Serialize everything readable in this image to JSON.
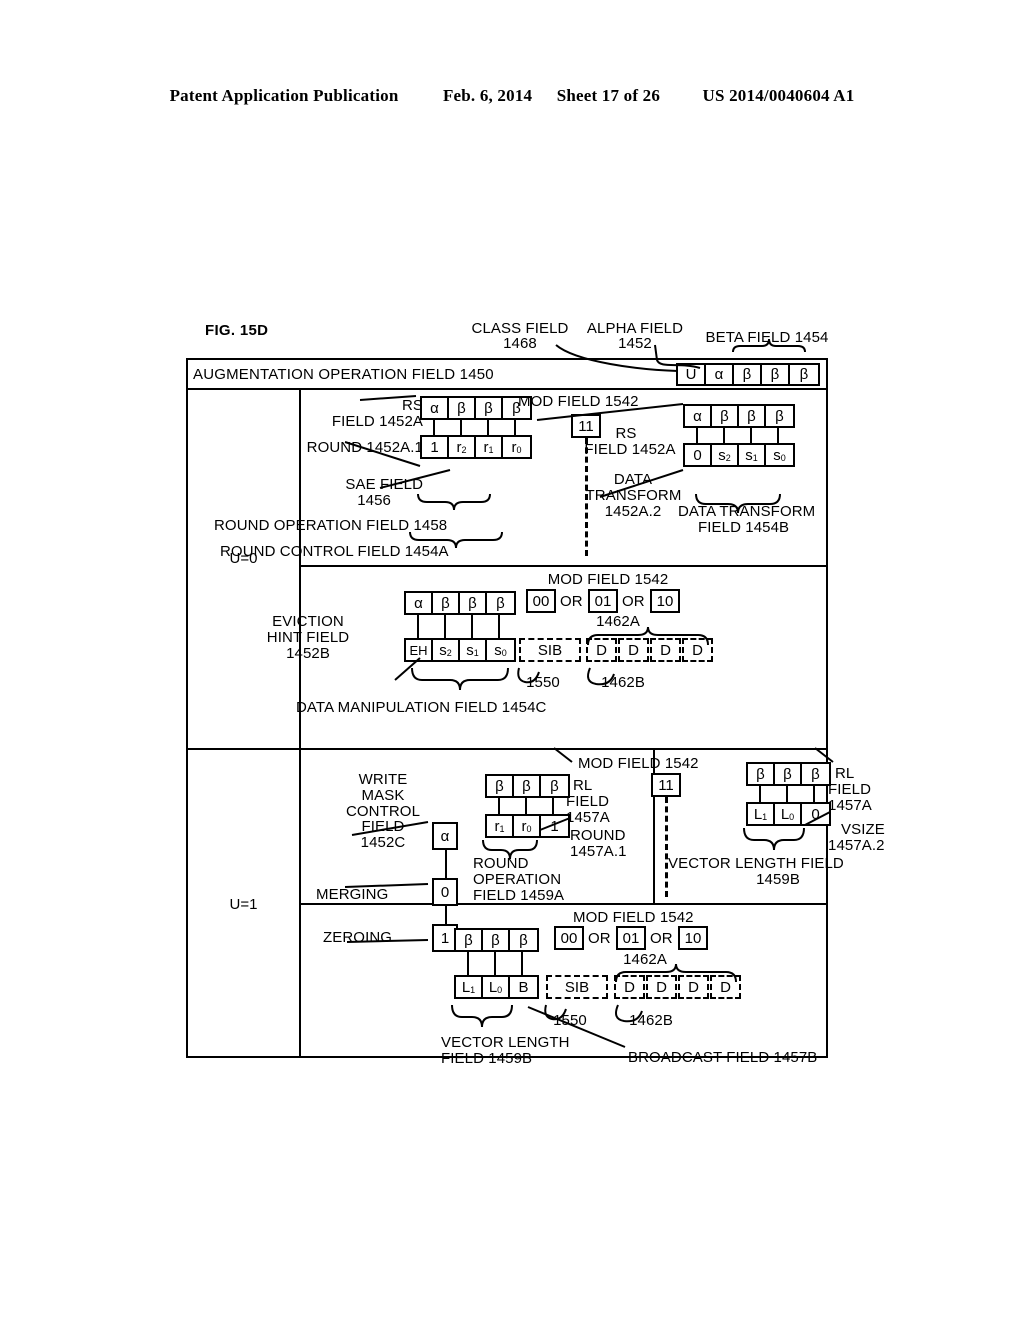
{
  "page_header": {
    "publication": "Patent Application Publication",
    "date": "Feb. 6, 2014",
    "sheet": "Sheet 17 of 26",
    "patent_number": "US 2014/0040604 A1"
  },
  "figure": {
    "label": "FIG. 15D",
    "header_row": {
      "title": "AUGMENTATION OPERATION FIELD 1450",
      "cells": [
        "U",
        "α",
        "β",
        "β",
        "β"
      ],
      "callouts": {
        "class_field": "CLASS FIELD\n1468",
        "alpha_field": "ALPHA FIELD\n1452",
        "beta_field": "BETA FIELD 1454"
      }
    },
    "rows": [
      {
        "u_label": "U=0",
        "sections": [
          {
            "name": "round-control",
            "labels": {
              "rs_field": "RS",
              "rs_field_num": "FIELD 1452A",
              "round": "ROUND 1452A.1",
              "sae_field": "SAE FIELD",
              "sae_num": "1456",
              "round_operation": "ROUND OPERATION FIELD 1458",
              "round_control": "ROUND CONTROL FIELD 1454A",
              "mod_field": "MOD FIELD 1542",
              "rs_field_r": "RS",
              "rs_field_r_num": "FIELD 1452A",
              "data_transform": "DATA",
              "data_transform2": "TRANSFORM",
              "data_transform_num": "1452A.2",
              "data_transform_field": "DATA TRANSFORM",
              "data_transform_field_num": "FIELD 1454B"
            },
            "top_cells": [
              "α",
              "β",
              "β",
              "β"
            ],
            "bottom_cells": [
              "1",
              "r2",
              "r1",
              "r0"
            ],
            "mod_value": "11",
            "top_cells_r": [
              "α",
              "β",
              "β",
              "β"
            ],
            "bottom_cells_r": [
              "0",
              "s2",
              "s1",
              "s0"
            ]
          },
          {
            "name": "data-manipulation",
            "labels": {
              "eviction_hint": "EVICTION",
              "eviction_hint2": "HINT FIELD",
              "eviction_hint_num": "1452B",
              "data_manipulation": "DATA MANIPULATION FIELD 1454C",
              "mod_field": "MOD FIELD 1542",
              "ref_1462a": "1462A",
              "ref_1550": "1550",
              "ref_1462b": "1462B"
            },
            "top_cells": [
              "α",
              "β",
              "β",
              "β"
            ],
            "bottom_cells": [
              "EH",
              "s2",
              "s1",
              "s0"
            ],
            "mod_values": [
              "00",
              "01",
              "10"
            ],
            "mod_or": "OR",
            "sib": "SIB",
            "disp_cells": [
              "D",
              "D",
              "D",
              "D"
            ]
          }
        ]
      },
      {
        "u_label": "U=1",
        "left_labels": {
          "write_mask": "WRITE\nMASK\nCONTROL\nFIELD\n1452C",
          "merging": "MERGING",
          "zeroing": "ZEROING",
          "alpha_cell": "α",
          "merging_cell": "0",
          "zeroing_cell": "1"
        },
        "sections": [
          {
            "name": "round-vsize",
            "labels": {
              "mod_field": "MOD FIELD 1542",
              "rl_field": "RL",
              "rl_field2": "FIELD",
              "rl_field_num": "1457A",
              "round": "ROUND",
              "round_num": "1457A.1",
              "round_operation": "ROUND\nOPERATION\nFIELD 1459A",
              "rl_field_r": "RL",
              "rl_field_r2": "FIELD",
              "rl_field_r_num": "1457A",
              "vsize": "VSIZE",
              "vsize_num": "1457A.2",
              "vector_length": "VECTOR LENGTH FIELD",
              "vector_length_num": "1459B"
            },
            "top_cells": [
              "β",
              "β",
              "β"
            ],
            "bottom_cells": [
              "r1",
              "r0",
              "1"
            ],
            "mod_value": "11",
            "top_cells_r": [
              "β",
              "β",
              "β"
            ],
            "bottom_cells_r": [
              "L1",
              "L0",
              "0"
            ]
          },
          {
            "name": "vector-length-broadcast",
            "labels": {
              "mod_field": "MOD FIELD 1542",
              "ref_1462a": "1462A",
              "ref_1550": "1550",
              "ref_1462b": "1462B",
              "vector_length": "VECTOR LENGTH",
              "vector_length_num": "FIELD 1459B",
              "broadcast": "BROADCAST FIELD 1457B"
            },
            "top_cells": [
              "β",
              "β",
              "β"
            ],
            "bottom_cells": [
              "L1",
              "L0",
              "B"
            ],
            "mod_values": [
              "00",
              "01",
              "10"
            ],
            "mod_or": "OR",
            "sib": "SIB",
            "disp_cells": [
              "D",
              "D",
              "D",
              "D"
            ]
          }
        ]
      }
    ]
  }
}
